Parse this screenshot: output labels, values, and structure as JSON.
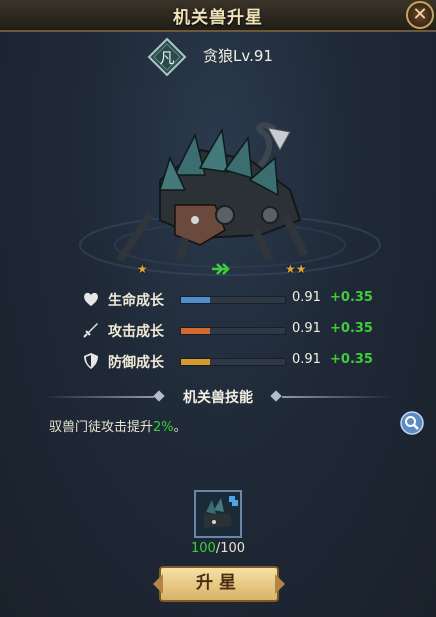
{
  "window": {
    "title": "机关兽升星",
    "close_icon": "close-icon"
  },
  "beast": {
    "class_glyph": "凡",
    "name": "贪狼Lv.91",
    "current_stars": 1,
    "next_stars": 2
  },
  "stats": [
    {
      "icon": "heart-icon",
      "label": "生命成长",
      "value": "0.91",
      "bonus": "+0.35",
      "fill": 0.28,
      "color": "#4f8fd0"
    },
    {
      "icon": "sword-icon",
      "label": "攻击成长",
      "value": "0.91",
      "bonus": "+0.35",
      "fill": 0.28,
      "color": "#d06a2e"
    },
    {
      "icon": "shield-icon",
      "label": "防御成长",
      "value": "0.91",
      "bonus": "+0.35",
      "fill": 0.28,
      "color": "#d49a2e"
    }
  ],
  "skill": {
    "title": "机关兽技能",
    "desc_prefix": "驭兽门徒攻击提升",
    "desc_value": "2%",
    "desc_suffix": "。"
  },
  "material": {
    "have": "100",
    "need": "/100"
  },
  "button": {
    "label": "升星"
  },
  "colors": {
    "accent_green": "#3fce3a",
    "gold": "#d9b268"
  }
}
